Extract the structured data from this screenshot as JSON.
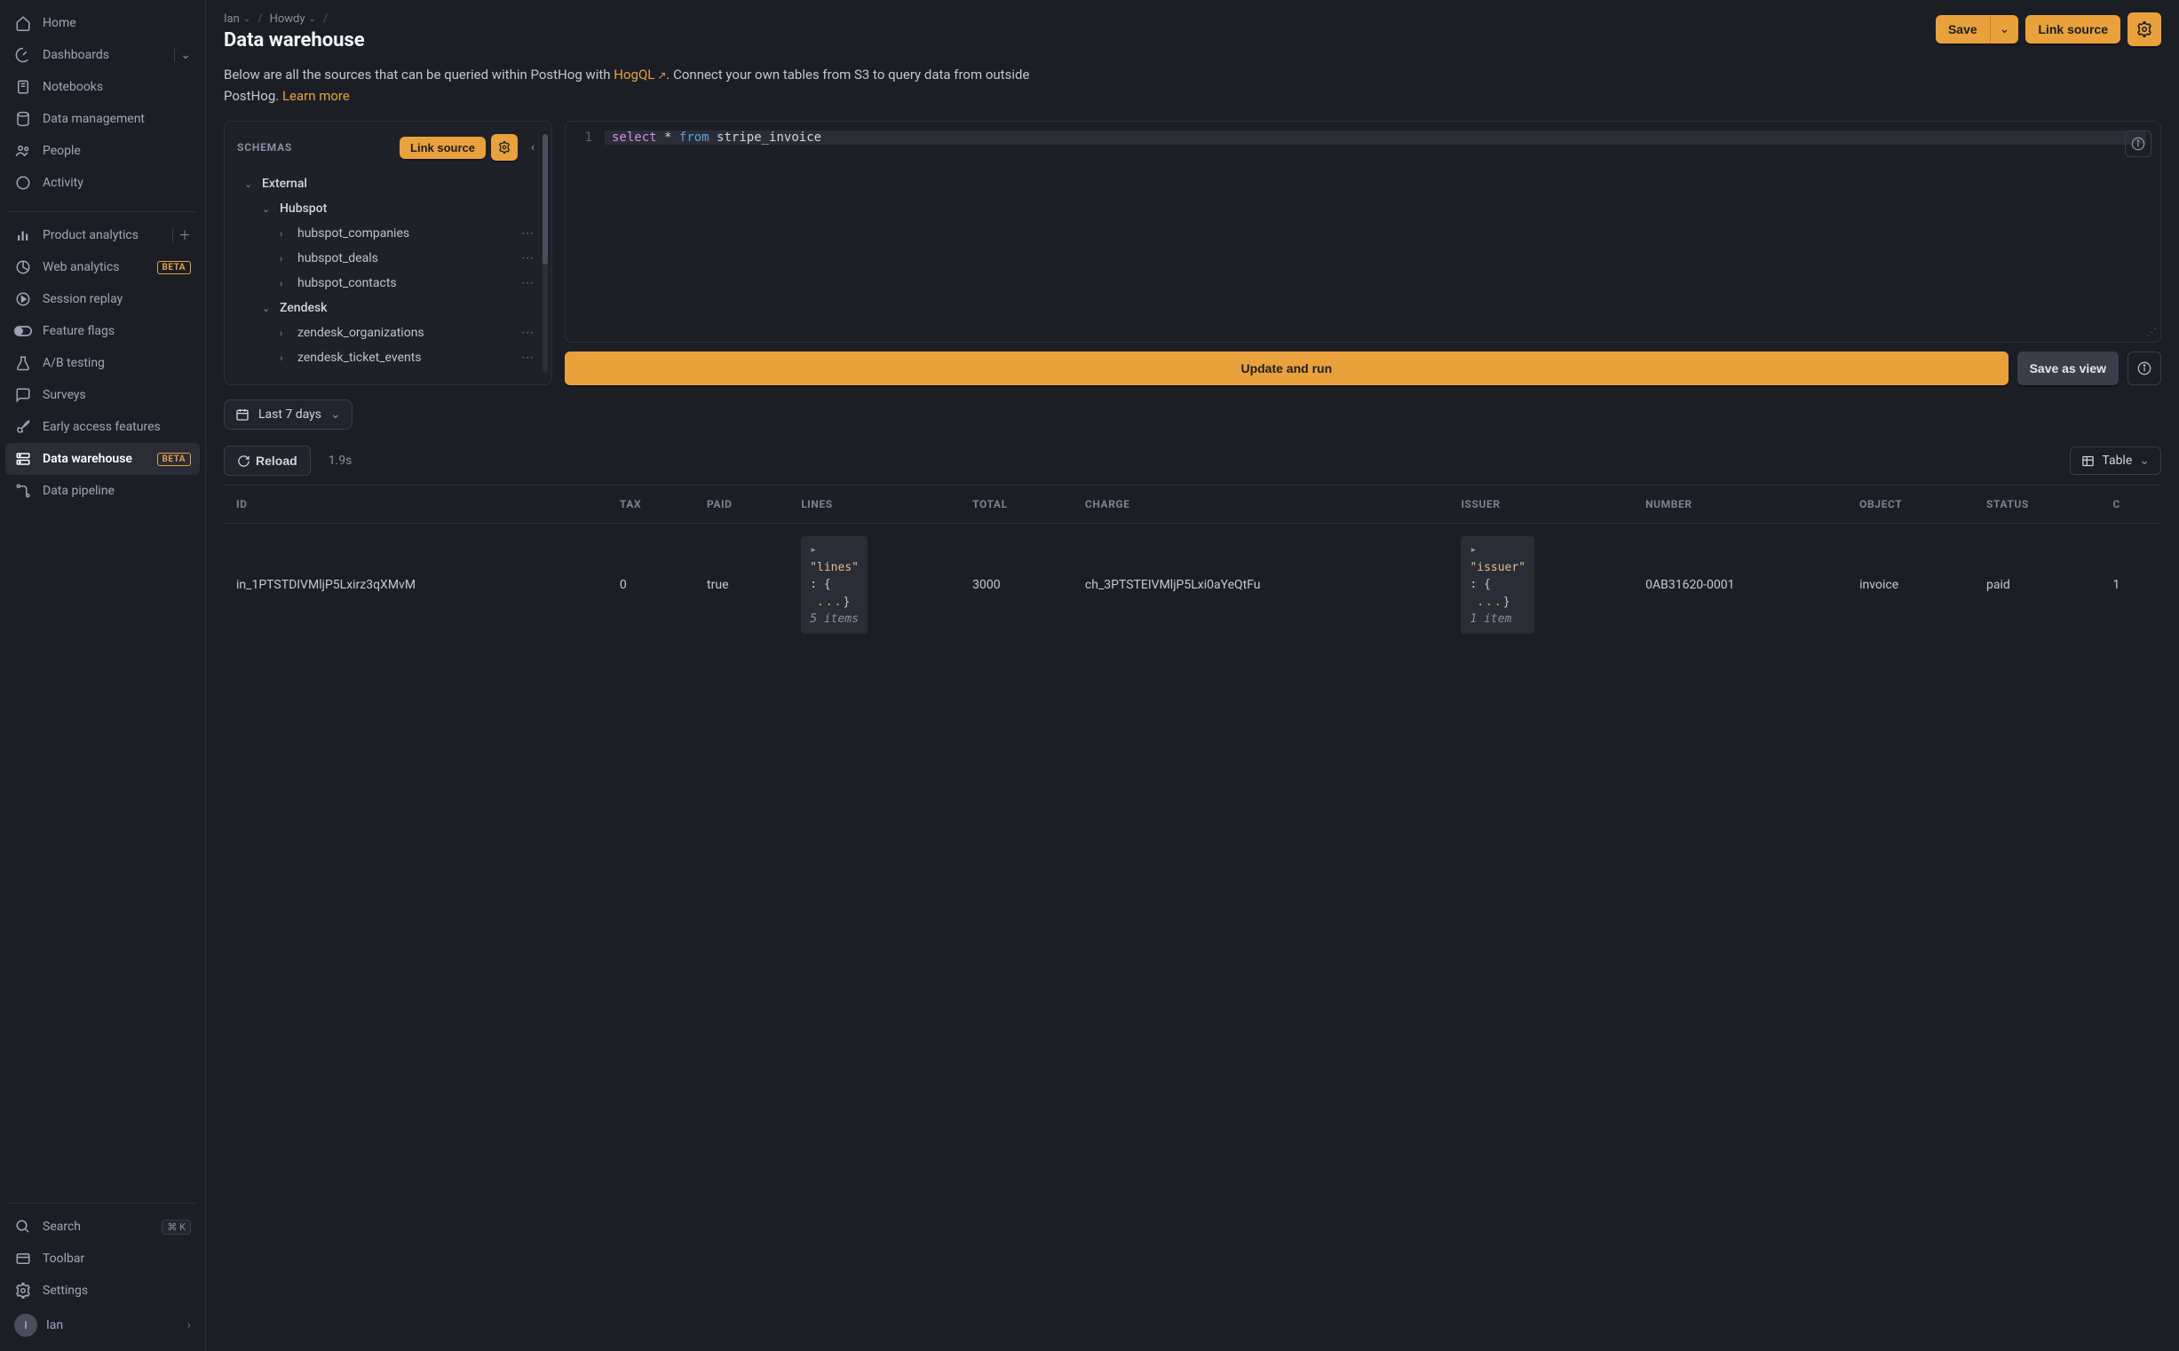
{
  "sidebar": {
    "nav_main": [
      {
        "label": "Home"
      },
      {
        "label": "Dashboards"
      },
      {
        "label": "Notebooks"
      },
      {
        "label": "Data management"
      },
      {
        "label": "People"
      },
      {
        "label": "Activity"
      }
    ],
    "nav_features": [
      {
        "label": "Product analytics"
      },
      {
        "label": "Web analytics",
        "badge": "BETA"
      },
      {
        "label": "Session replay"
      },
      {
        "label": "Feature flags"
      },
      {
        "label": "A/B testing"
      },
      {
        "label": "Surveys"
      },
      {
        "label": "Early access features"
      },
      {
        "label": "Data warehouse",
        "badge": "BETA"
      },
      {
        "label": "Data pipeline"
      }
    ],
    "nav_bottom": [
      {
        "label": "Search",
        "kbd": "⌘ K"
      },
      {
        "label": "Toolbar"
      },
      {
        "label": "Settings"
      }
    ],
    "user": {
      "initial": "I",
      "name": "Ian"
    }
  },
  "breadcrumb": {
    "crumb1": "Ian",
    "crumb2": "Howdy"
  },
  "page_title": "Data warehouse",
  "top_actions": {
    "save": "Save",
    "link_source": "Link source"
  },
  "intro": {
    "before": "Below are all the sources that can be queried within PostHog with ",
    "link1": "HogQL",
    "mid": ". Connect your own tables from S3 to query data from outside PostHog. ",
    "link2": "Learn more"
  },
  "schemas": {
    "title": "SCHEMAS",
    "link_btn": "Link source",
    "tree": {
      "external": "External",
      "hubspot": "Hubspot",
      "hubspot_items": [
        "hubspot_companies",
        "hubspot_deals",
        "hubspot_contacts"
      ],
      "zendesk": "Zendesk",
      "zendesk_items": [
        "zendesk_organizations",
        "zendesk_ticket_events"
      ]
    }
  },
  "editor": {
    "line_no": "1",
    "kw_select": "select",
    "kw_star": "*",
    "kw_from": "from",
    "table": "stripe_invoice",
    "update_btn": "Update and run",
    "save_view_btn": "Save as view"
  },
  "date_range": "Last 7 days",
  "results_bar": {
    "reload": "Reload",
    "timing": "1.9s",
    "view": "Table"
  },
  "table": {
    "columns": [
      "ID",
      "TAX",
      "PAID",
      "LINES",
      "TOTAL",
      "CHARGE",
      "ISSUER",
      "NUMBER",
      "OBJECT",
      "STATUS",
      "C"
    ],
    "row": {
      "id": "in_1PTSTDIVMljP5Lxirz3qXMvM",
      "tax": "0",
      "paid": "true",
      "lines_key": "\"lines\"",
      "lines_count": "5 items",
      "total": "3000",
      "charge": "ch_3PTSTEIVMljP5Lxi0aYeQtFu",
      "issuer_key": "\"issuer\"",
      "issuer_count": "1 item",
      "number": "0AB31620-0001",
      "object": "invoice",
      "status": "paid",
      "trunc": "1"
    }
  },
  "colors": {
    "accent": "#e9a13c"
  }
}
